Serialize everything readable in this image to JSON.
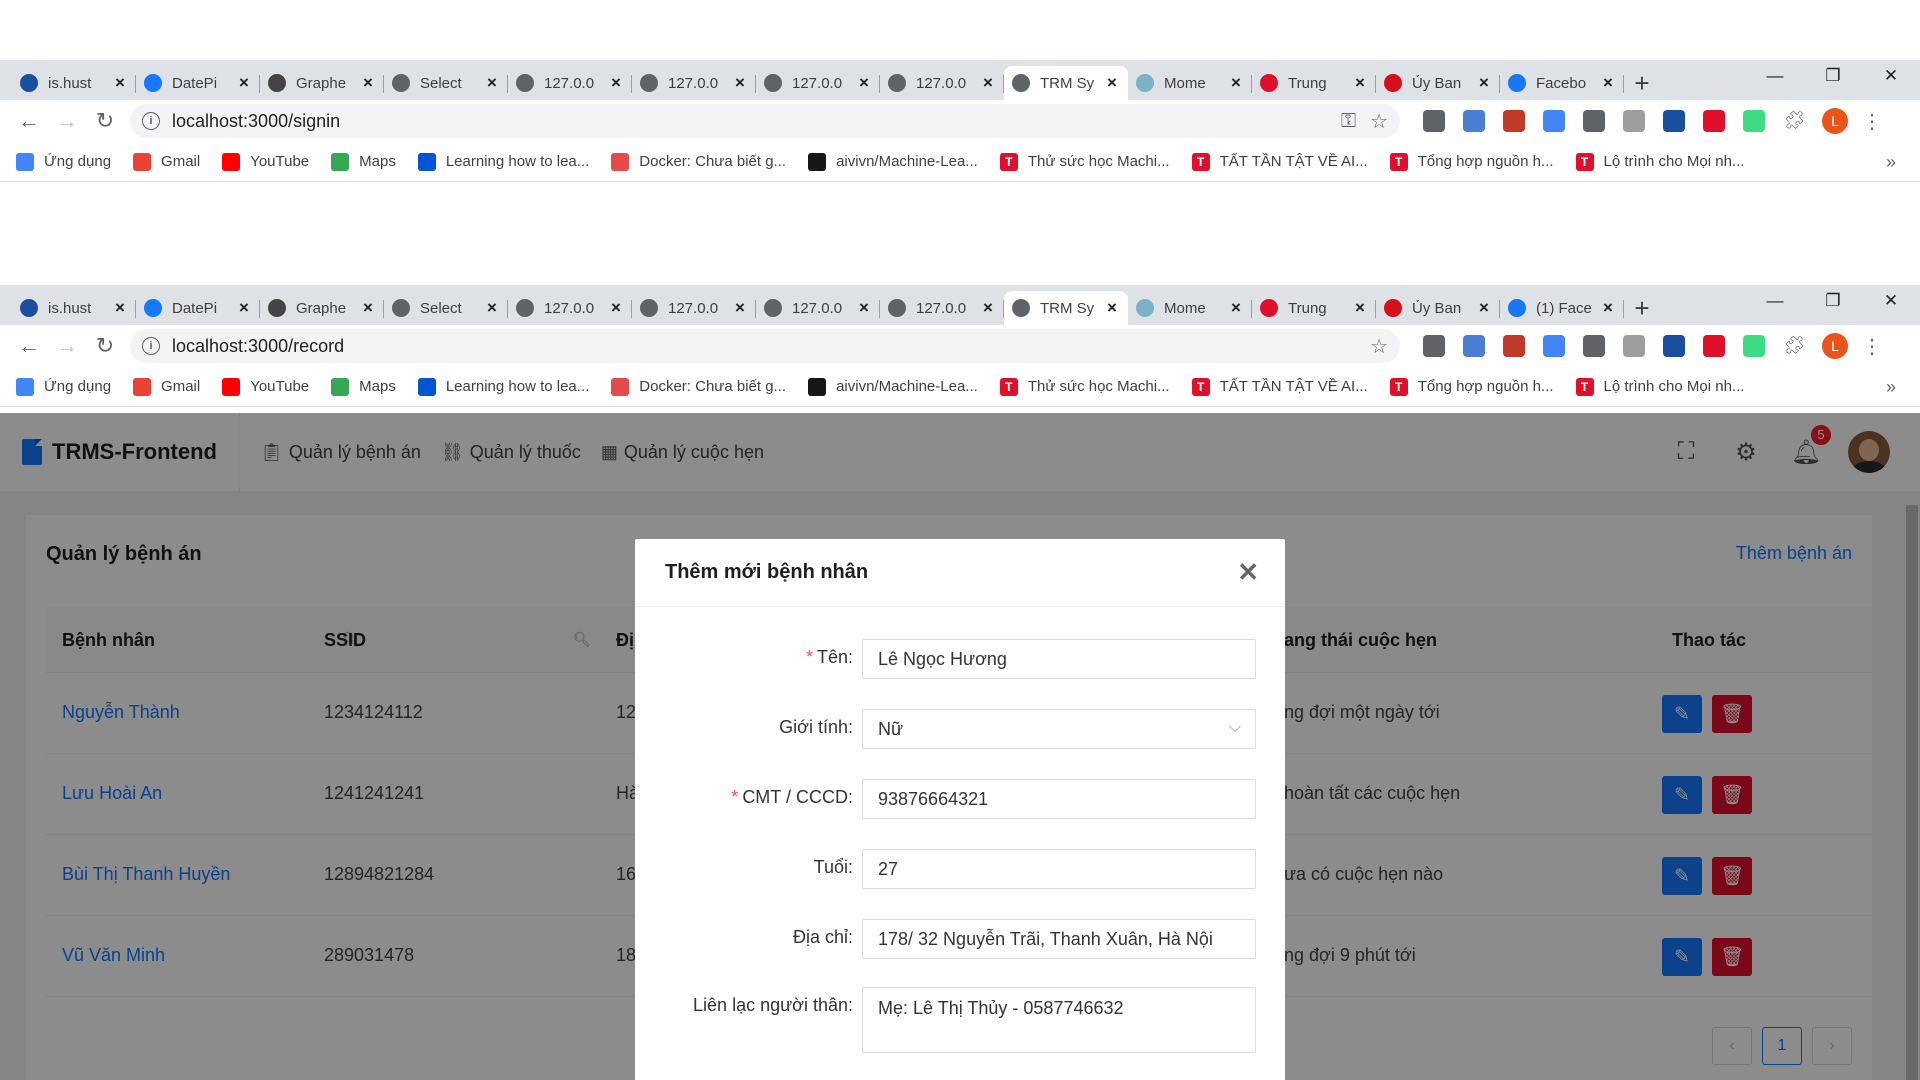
{
  "browser_tabs": [
    {
      "title": "is.hust",
      "icon": "hust-icon",
      "color": "#1a4fa0"
    },
    {
      "title": "DatePi",
      "icon": "datepicker-icon",
      "color": "#1677ff"
    },
    {
      "title": "Graphe",
      "icon": "grapher-icon",
      "color": "#444444"
    },
    {
      "title": "Select",
      "icon": "globe-icon",
      "color": "#5f6368"
    },
    {
      "title": "127.0.0",
      "icon": "globe-icon",
      "color": "#5f6368"
    },
    {
      "title": "127.0.0",
      "icon": "globe-icon",
      "color": "#5f6368"
    },
    {
      "title": "127.0.0",
      "icon": "globe-icon",
      "color": "#5f6368"
    },
    {
      "title": "127.0.0",
      "icon": "globe-icon",
      "color": "#5f6368"
    },
    {
      "title": "TRM Sy",
      "icon": "globe-icon",
      "color": "#5f6368",
      "active": true
    },
    {
      "title": "Mome",
      "icon": "moment-icon",
      "color": "#7ab3c7"
    },
    {
      "title": "Trung",
      "icon": "trung-icon",
      "color": "#e0102c"
    },
    {
      "title": "Ủy Ban",
      "icon": "emblem-icon",
      "color": "#d4101c"
    },
    {
      "title": "Facebo",
      "icon": "facebook-icon",
      "color": "#1877f2"
    }
  ],
  "browser_tabs_2_last": "(1) Face",
  "window1": {
    "url": "localhost:3000/signin"
  },
  "window2": {
    "url": "localhost:3000/record"
  },
  "bookmarks": [
    {
      "label": "Ứng dụng",
      "icon": "apps-grid-icon",
      "color": "#4285f4"
    },
    {
      "label": "Gmail",
      "icon": "gmail-icon",
      "color": "#ea4335"
    },
    {
      "label": "YouTube",
      "icon": "youtube-icon",
      "color": "#ff0000"
    },
    {
      "label": "Maps",
      "icon": "maps-icon",
      "color": "#34a853"
    },
    {
      "label": "Learning how to lea...",
      "icon": "coursera-icon",
      "color": "#0056d2"
    },
    {
      "label": "Docker: Chưa biết g...",
      "icon": "viblo-icon",
      "color": "#e44c4c"
    },
    {
      "label": "aivivn/Machine-Lea...",
      "icon": "github-icon",
      "color": "#181717"
    },
    {
      "label": "Thử sức học Machi...",
      "icon": "t-icon",
      "color": "#e0102c"
    },
    {
      "label": "TẤT TẦN TẬT VỀ AI...",
      "icon": "t-icon",
      "color": "#e0102c"
    },
    {
      "label": "Tổng hợp nguồn h...",
      "icon": "t-icon",
      "color": "#e0102c"
    },
    {
      "label": "Lộ trình cho Mọi nh...",
      "icon": "t-icon",
      "color": "#e0102c"
    }
  ],
  "profile_initial": "L",
  "app": {
    "brand": "TRMS-Frontend",
    "menu": [
      {
        "label": "Quản lý bệnh án",
        "icon": "clipboard-icon"
      },
      {
        "label": "Quản lý thuốc",
        "icon": "link-icon"
      },
      {
        "label": "Quản lý cuộc hẹn",
        "icon": "calendar-icon"
      }
    ],
    "notification_count": "5",
    "accent": "#1677ff"
  },
  "card": {
    "title": "Quản lý bệnh án",
    "add_label": "Thêm bệnh án"
  },
  "table": {
    "headers": {
      "patient": "Bệnh nhân",
      "ssid": "SSID",
      "address": "Đị",
      "status": "ang thái cuộc hẹn",
      "actions": "Thao tác"
    },
    "rows": [
      {
        "name": "Nguyễn Thành",
        "ssid": "1234124112",
        "addr": "12",
        "status": "ng đợi một ngày tới"
      },
      {
        "name": "Lưu Hoài An",
        "ssid": "1241241241",
        "addr": "Hà",
        "status": "hoàn tất các cuộc hẹn"
      },
      {
        "name": "Bùi Thị Thanh Huyền",
        "ssid": "12894821284",
        "addr": "16",
        "status": "ưa có cuộc hẹn nào"
      },
      {
        "name": "Vũ Văn Minh",
        "ssid": "289031478",
        "addr": "18",
        "status": "ng đợi 9 phút tới"
      }
    ],
    "page": "1"
  },
  "modal": {
    "title": "Thêm mới bệnh nhân",
    "fields": {
      "name": {
        "label": "Tên",
        "value": "Lê Ngọc Hương",
        "required": true
      },
      "gender": {
        "label": "Giới tính",
        "value": "Nữ"
      },
      "id_card": {
        "label": "CMT / CCCD",
        "value": "93876664321",
        "required": true
      },
      "age": {
        "label": "Tuổi",
        "value": "27"
      },
      "address": {
        "label": "Địa chỉ",
        "value": "178/ 32 Nguyễn Trãi, Thanh Xuân, Hà Nội"
      },
      "relative": {
        "label": "Liên lạc người thân",
        "value": "Mẹ: Lê Thị Thủy - 0587746632"
      }
    },
    "colon": ":",
    "required_mark": "*"
  }
}
